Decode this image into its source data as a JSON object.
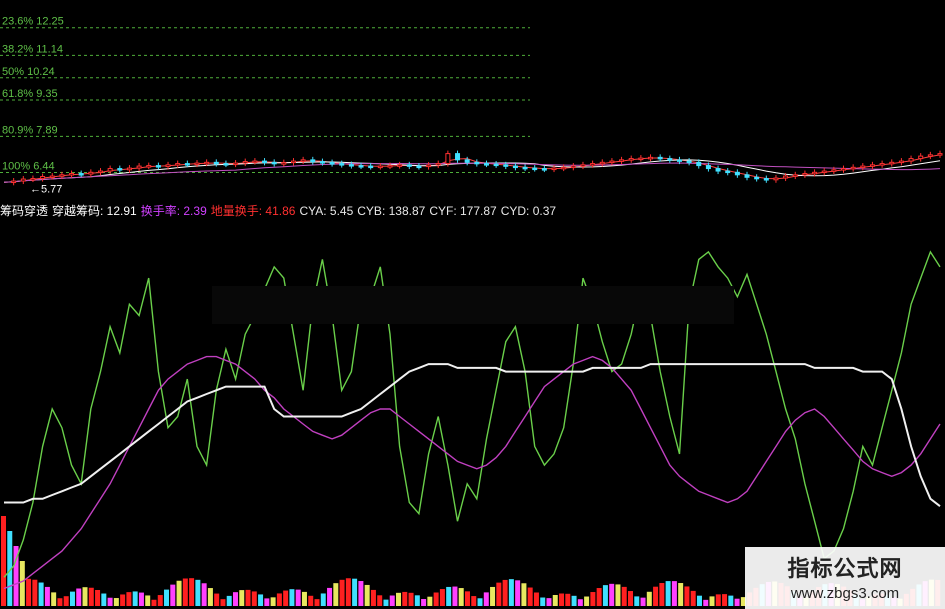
{
  "price_panel": {
    "fib_levels": [
      {
        "label": "23.6% 12.25",
        "price": 12.25
      },
      {
        "label": "38.2% 11.14",
        "price": 11.14
      },
      {
        "label": "50% 10.24",
        "price": 10.24
      },
      {
        "label": "61.8% 9.35",
        "price": 9.35
      },
      {
        "label": "80.9% 7.89",
        "price": 7.89
      },
      {
        "label": "100% 6.44",
        "price": 6.44
      }
    ],
    "low_marker": "5.77",
    "range": [
      5.5,
      13.2
    ],
    "close": [
      6.05,
      6.1,
      6.18,
      6.2,
      6.28,
      6.3,
      6.35,
      6.4,
      6.38,
      6.45,
      6.5,
      6.6,
      6.55,
      6.62,
      6.7,
      6.72,
      6.68,
      6.75,
      6.8,
      6.78,
      6.82,
      6.85,
      6.8,
      6.78,
      6.82,
      6.88,
      6.9,
      6.85,
      6.8,
      6.84,
      6.9,
      6.95,
      6.88,
      6.84,
      6.8,
      6.76,
      6.72,
      6.7,
      6.68,
      6.7,
      6.72,
      6.75,
      6.7,
      6.68,
      6.74,
      6.8,
      7.2,
      6.95,
      6.85,
      6.8,
      6.78,
      6.75,
      6.7,
      6.65,
      6.62,
      6.6,
      6.58,
      6.62,
      6.65,
      6.7,
      6.75,
      6.8,
      6.85,
      6.9,
      6.95,
      7.0,
      7.02,
      7.05,
      7.0,
      6.95,
      6.9,
      6.85,
      6.72,
      6.6,
      6.5,
      6.45,
      6.35,
      6.25,
      6.2,
      6.15,
      6.22,
      6.3,
      6.35,
      6.4,
      6.45,
      6.5,
      6.55,
      6.6,
      6.65,
      6.7,
      6.75,
      6.8,
      6.85,
      6.9,
      7.0,
      7.1,
      7.15,
      7.2
    ]
  },
  "indicator_legend": [
    {
      "text": "筹码穿透",
      "color": "#ffffff"
    },
    {
      "text": "穿越筹码: 12.91",
      "color": "#ffffff"
    },
    {
      "text": "换手率: 2.39",
      "color": "#d040ff"
    },
    {
      "text": "地量换手: 41.86",
      "color": "#ff3030"
    },
    {
      "text": "CYA: 5.45",
      "color": "#e8e8e8"
    },
    {
      "text": "CYB: 138.87",
      "color": "#e8e8e8"
    },
    {
      "text": "CYF: 177.87",
      "color": "#e8e8e8"
    },
    {
      "text": "CYD: 0.37",
      "color": "#e8e8e8"
    }
  ],
  "chart_data": {
    "type": "line",
    "ylim": [
      0,
      100
    ],
    "series": [
      {
        "color": "#6acf4a",
        "values": [
          5,
          8,
          15,
          25,
          40,
          50,
          45,
          35,
          30,
          50,
          60,
          72,
          65,
          78,
          75,
          85,
          60,
          45,
          48,
          58,
          40,
          35,
          55,
          66,
          58,
          70,
          75,
          82,
          88,
          85,
          70,
          55,
          78,
          90,
          75,
          55,
          60,
          78,
          80,
          88,
          70,
          40,
          25,
          22,
          38,
          48,
          35,
          20,
          30,
          26,
          42,
          55,
          68,
          72,
          60,
          40,
          35,
          38,
          45,
          62,
          85,
          78,
          68,
          60,
          62,
          70,
          82,
          75,
          60,
          48,
          38,
          78,
          90,
          92,
          88,
          85,
          80,
          86,
          78,
          70,
          60,
          50,
          42,
          30,
          20,
          10,
          12,
          18,
          28,
          40,
          35,
          45,
          55,
          65,
          78,
          85,
          92,
          88
        ]
      },
      {
        "color": "#c040c0",
        "values": [
          2,
          3,
          4,
          6,
          8,
          10,
          12,
          15,
          18,
          22,
          26,
          30,
          35,
          40,
          45,
          50,
          55,
          58,
          60,
          62,
          63,
          64,
          64,
          63,
          62,
          60,
          58,
          55,
          53,
          50,
          48,
          46,
          44,
          43,
          42,
          43,
          45,
          47,
          49,
          50,
          50,
          48,
          46,
          44,
          42,
          40,
          38,
          36,
          35,
          34,
          35,
          37,
          40,
          44,
          48,
          52,
          56,
          58,
          60,
          62,
          63,
          64,
          63,
          61,
          58,
          55,
          50,
          45,
          40,
          35,
          32,
          30,
          28,
          27,
          26,
          25,
          26,
          28,
          32,
          36,
          40,
          44,
          47,
          49,
          50,
          48,
          45,
          42,
          39,
          36,
          34,
          33,
          32,
          33,
          35,
          38,
          42,
          46
        ]
      },
      {
        "color": "#f0f0f0",
        "values": [
          25,
          25,
          25,
          26,
          26,
          27,
          28,
          29,
          30,
          32,
          34,
          36,
          38,
          40,
          42,
          44,
          46,
          48,
          50,
          52,
          53,
          54,
          55,
          56,
          56,
          56,
          56,
          56,
          50,
          48,
          48,
          48,
          48,
          48,
          48,
          48,
          49,
          50,
          52,
          54,
          56,
          58,
          60,
          61,
          62,
          62,
          62,
          61,
          61,
          61,
          61,
          61,
          60,
          60,
          60,
          60,
          60,
          60,
          60,
          60,
          60,
          61,
          61,
          61,
          61,
          61,
          61,
          62,
          62,
          62,
          62,
          62,
          62,
          62,
          62,
          62,
          62,
          62,
          62,
          62,
          62,
          62,
          62,
          62,
          61,
          61,
          61,
          61,
          61,
          60,
          60,
          60,
          58,
          50,
          40,
          32,
          26,
          24
        ]
      }
    ]
  },
  "volume_colors": [
    "#ff2020",
    "#e8e860",
    "#ff40ff",
    "#40e0ff"
  ],
  "watermark": {
    "title": "指标公式网",
    "url": "www.zbgs3.com"
  }
}
